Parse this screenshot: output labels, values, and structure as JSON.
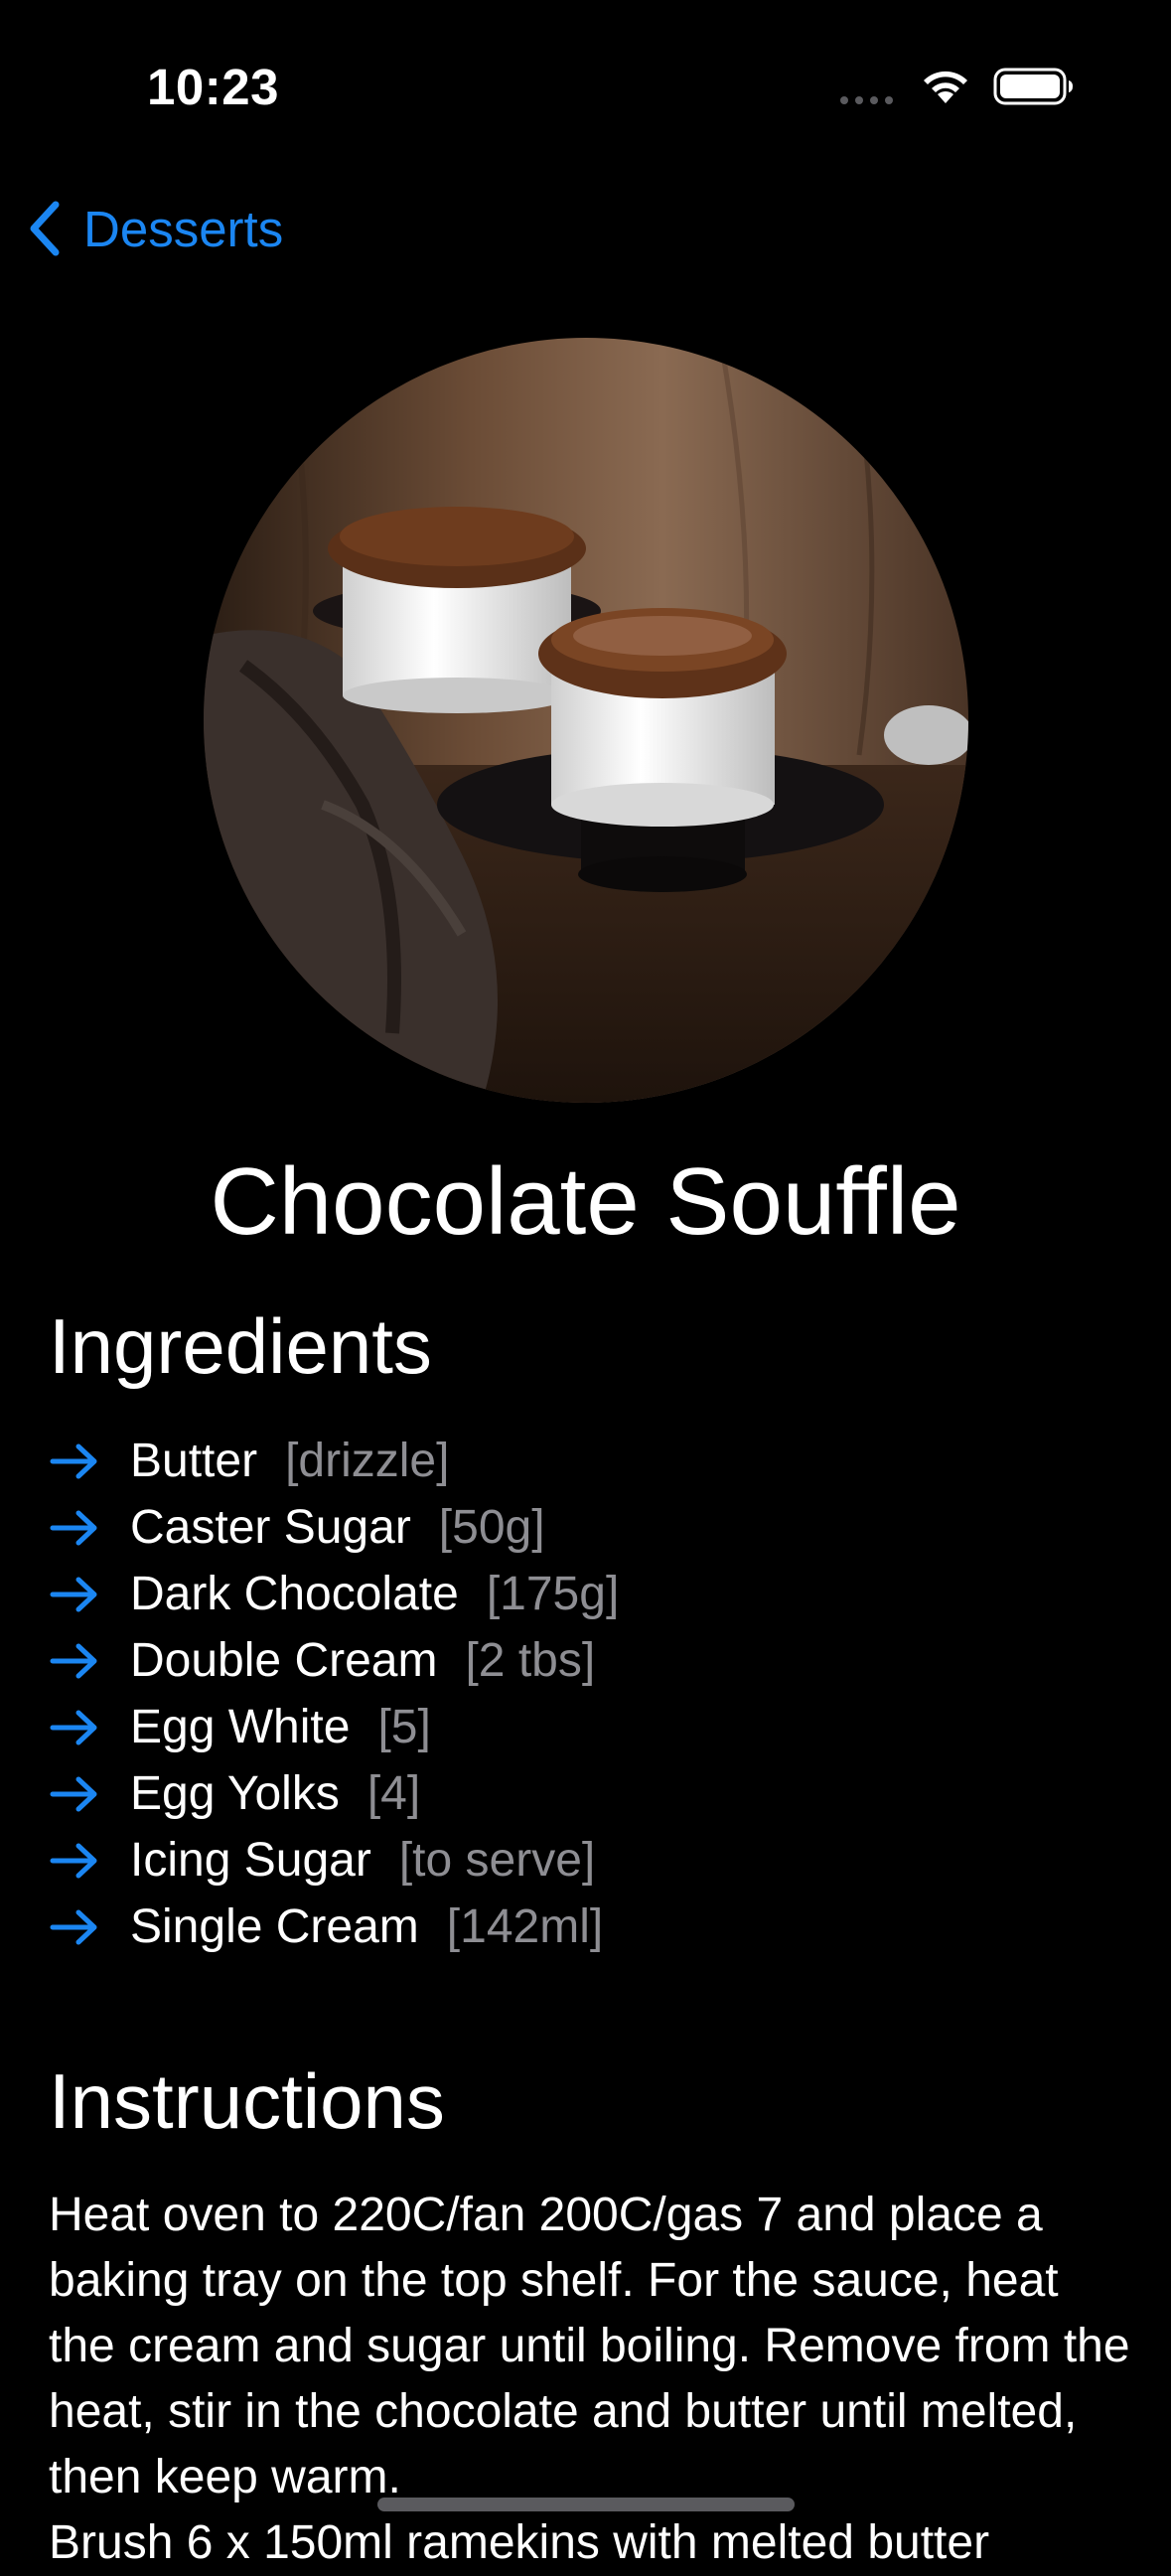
{
  "status_bar": {
    "time": "10:23"
  },
  "nav": {
    "back_label": "Desserts",
    "back_icon": "chevron-left-icon"
  },
  "hero_image": {
    "icon": "chocolate-souffle-photo"
  },
  "recipe": {
    "title": "Chocolate Souffle",
    "ingredients_heading": "Ingredients",
    "ingredients": [
      {
        "name": "Butter",
        "qty": "[drizzle]"
      },
      {
        "name": "Caster Sugar",
        "qty": "[50g]"
      },
      {
        "name": "Dark Chocolate",
        "qty": "[175g]"
      },
      {
        "name": "Double Cream",
        "qty": "[2 tbs]"
      },
      {
        "name": "Egg White",
        "qty": "[5]"
      },
      {
        "name": "Egg Yolks",
        "qty": "[4]"
      },
      {
        "name": "Icing Sugar",
        "qty": "[to serve]"
      },
      {
        "name": "Single Cream",
        "qty": "[142ml]"
      }
    ],
    "instructions_heading": "Instructions",
    "instructions": "Heat oven to 220C/fan 200C/gas 7 and place a baking tray on the top shelf. For the sauce, heat the cream and sugar until boiling. Remove from the heat, stir in the chocolate and butter until melted, then keep warm.\nBrush 6 x 150ml ramekins with melted butter"
  },
  "colors": {
    "accent": "#1b86f2",
    "background": "#000000",
    "secondary_text": "#8e8e93"
  }
}
